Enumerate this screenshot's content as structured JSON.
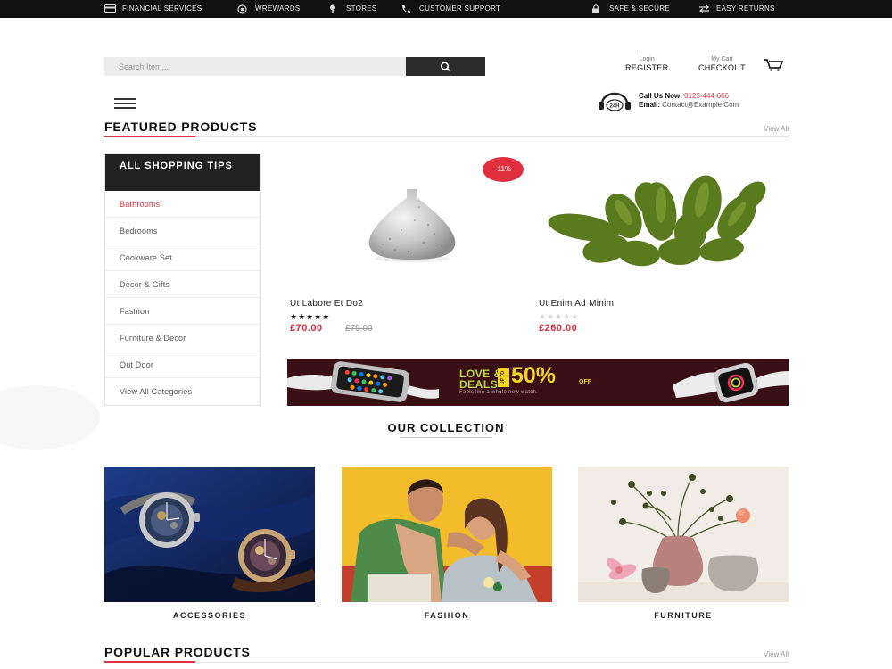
{
  "topbar": {
    "financial": "FINANCIAL SERVICES",
    "rewards": "WREWARDS",
    "stores": "STORES",
    "support": "CUSTOMER SUPPORT",
    "secure": "SAFE & SECURE",
    "returns": "EASY RETURNS"
  },
  "search": {
    "placeholder": "Search Item..."
  },
  "account": {
    "login_small": "Login",
    "register": "REGISTER",
    "cart_small": "My Cart",
    "checkout": "CHECKOUT"
  },
  "contact": {
    "call_label": "Call Us Now:",
    "phone": "0123-444-666",
    "email_label": "Email:",
    "email": "Contact@Example.Com",
    "icon_text": "24H"
  },
  "featured": {
    "title": "FEATURED PRODUCTS",
    "view_all": "View All"
  },
  "categories": {
    "heading": "ALL SHOPPING TIPS",
    "items": [
      "Bathrooms",
      "Bedrooms",
      "Cookware Set",
      "Decor & Gifts",
      "Fashion",
      "Furniture & Decor",
      "Out Door",
      "View All Categories"
    ]
  },
  "products": [
    {
      "name": "Ut Labore Et Do2",
      "price": "£70.00",
      "old_price": "£79.00",
      "badge": "-11%",
      "rating": 5
    },
    {
      "name": "Ut Enim Ad Minim",
      "price": "£260.00",
      "rating": 0
    }
  ],
  "banner": {
    "line1": "LOVE &",
    "line2": "DEALS",
    "upto": "UP TO",
    "percent": "50%",
    "off": "OFF",
    "tagline": "Feels like a whole new watch."
  },
  "collection": {
    "title": "OUR COLLECTION",
    "tiles": [
      "ACCESSORIES",
      "FASHION",
      "FURNITURE"
    ]
  },
  "popular": {
    "title": "POPULAR PRODUCTS",
    "view_all": "View All"
  },
  "colors": {
    "accent": "#e03040",
    "dark": "#222222",
    "banner_bg": "#3a1016",
    "banner_green": "#b6d63a",
    "banner_yellow": "#f3d41f"
  }
}
